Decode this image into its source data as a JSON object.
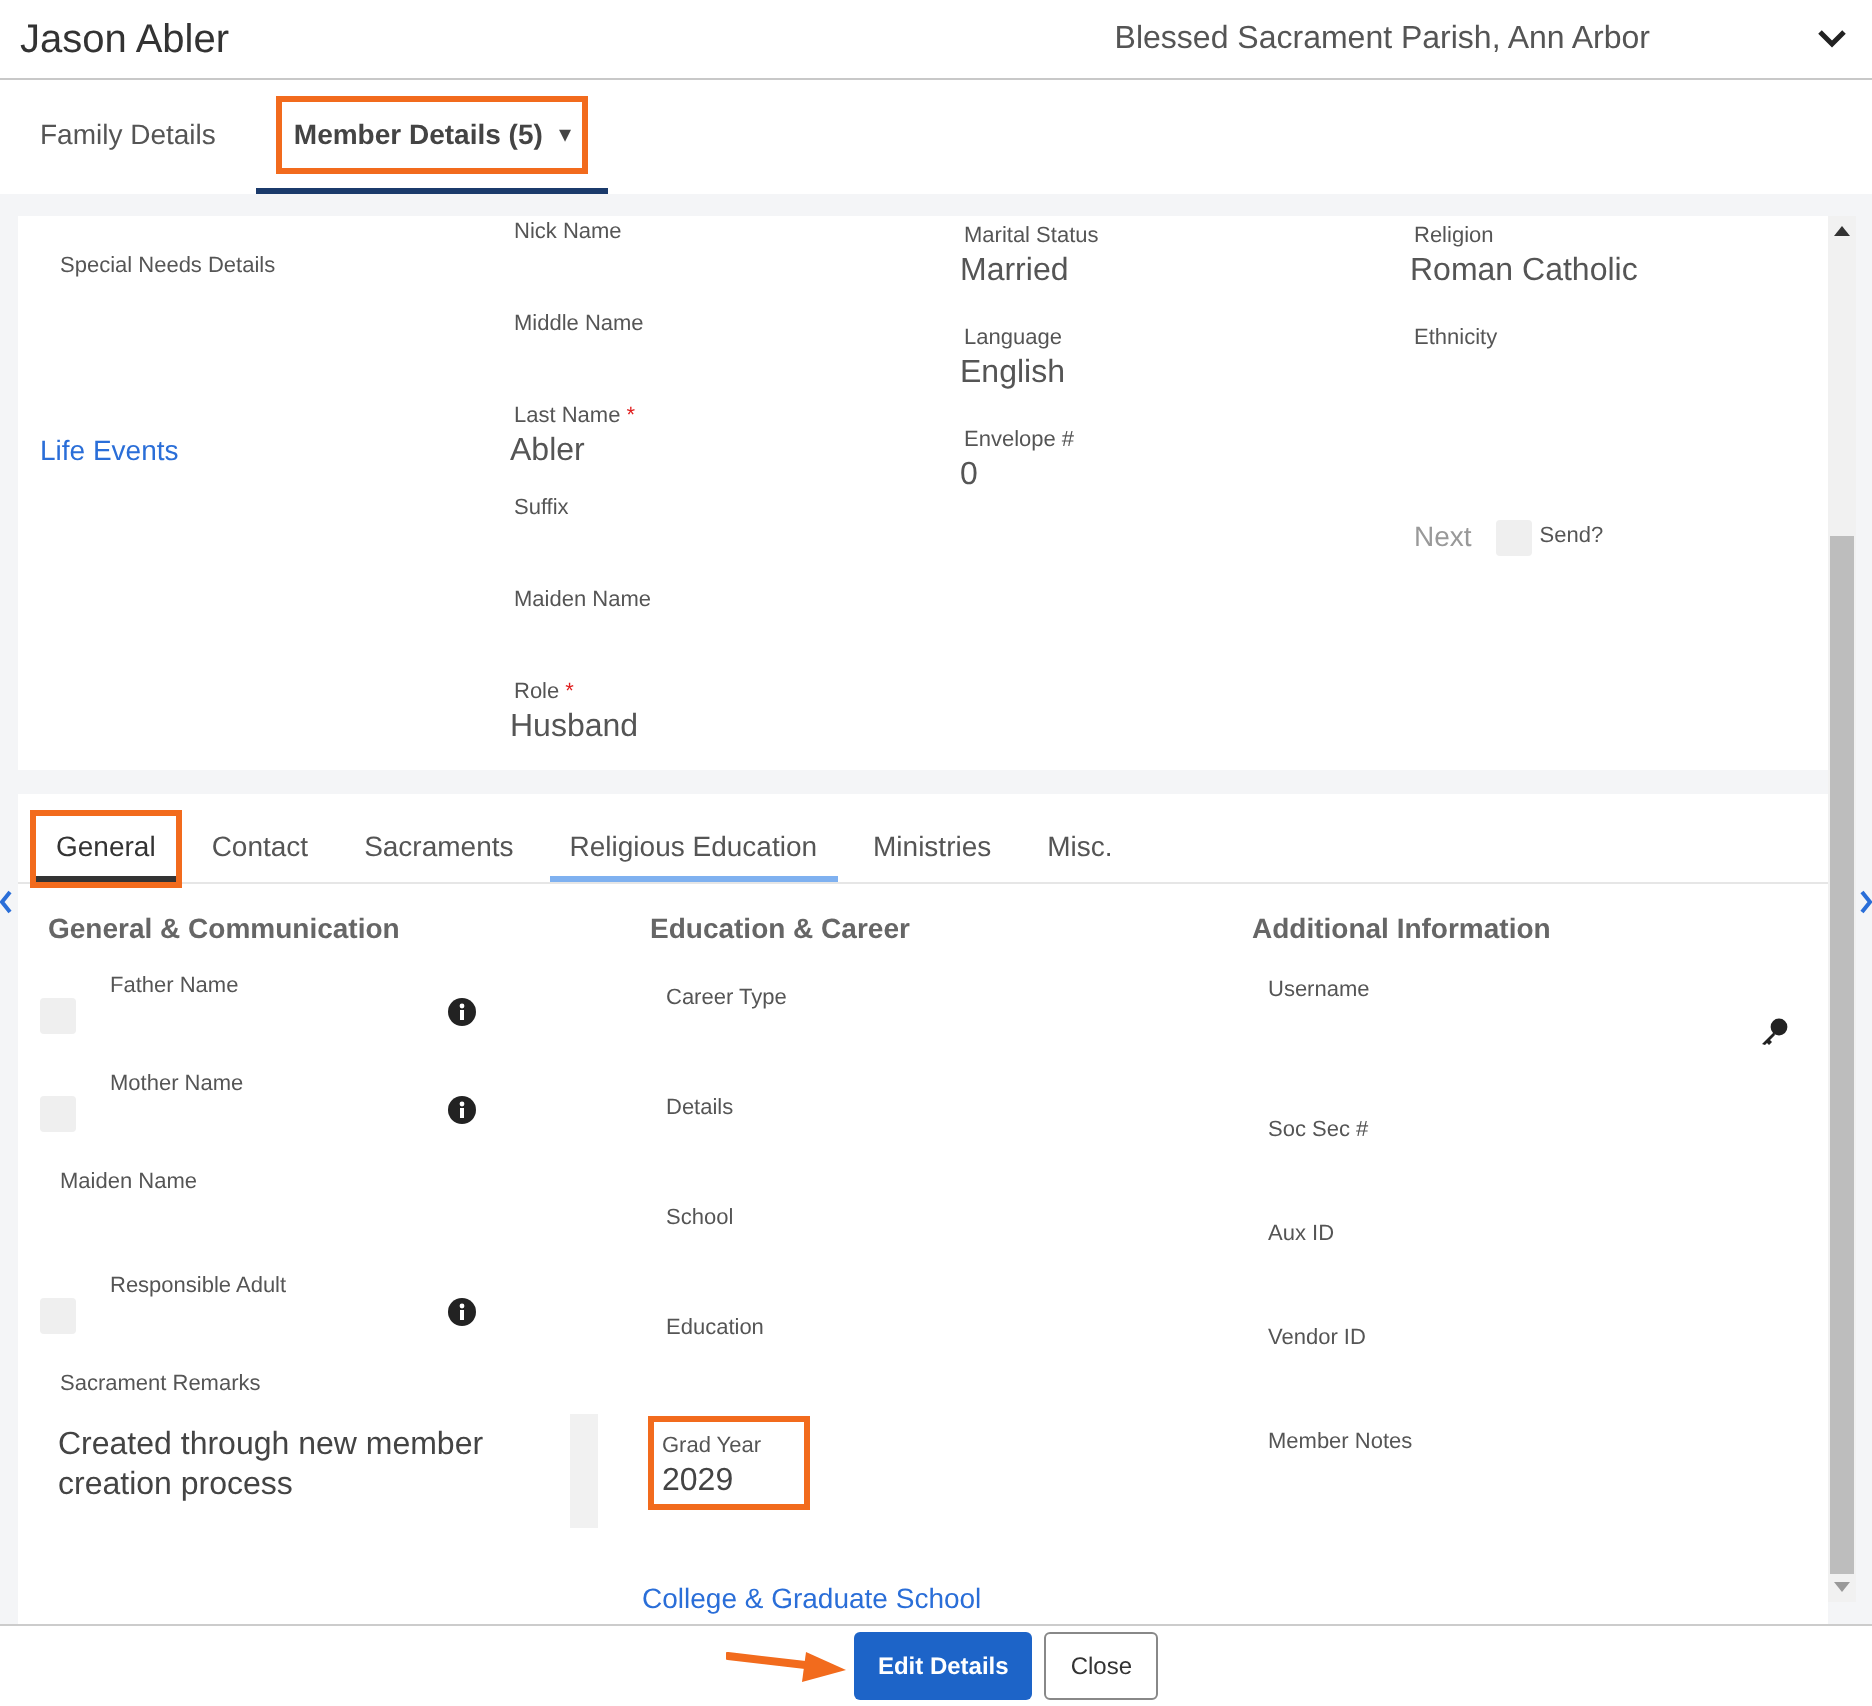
{
  "header": {
    "title": "Jason Abler",
    "parish": "Blessed Sacrament Parish, Ann Arbor"
  },
  "tabs": [
    {
      "label": "Family Details",
      "selected": false,
      "highlighted": false,
      "dropdown": false
    },
    {
      "label": "Member Details (5)",
      "selected": true,
      "highlighted": true,
      "dropdown": "▾"
    }
  ],
  "summary": {
    "columns": [
      [
        {
          "kind": "field",
          "label": "Special Needs Details"
        },
        {
          "kind": "link",
          "label": "Life Events"
        }
      ],
      [
        {
          "kind": "field",
          "label": "Nick Name"
        },
        {
          "kind": "field",
          "label": "Middle Name"
        },
        {
          "kind": "field",
          "label": "Last Name",
          "required_mark": "*",
          "value": "Abler"
        },
        {
          "kind": "field",
          "label": "Suffix"
        },
        {
          "kind": "field",
          "label": "Maiden Name"
        },
        {
          "kind": "field",
          "label": "Role",
          "required_mark": "*",
          "value": "Husband"
        }
      ],
      [
        {
          "kind": "field",
          "label": "Marital Status",
          "value": "Married"
        },
        {
          "kind": "field",
          "label": "Language",
          "value": "English"
        },
        {
          "kind": "field",
          "label": "Envelope #",
          "value": "0"
        }
      ],
      [
        {
          "kind": "field",
          "label": "Religion",
          "value": "Roman Catholic"
        },
        {
          "kind": "field",
          "label": "Ethnicity"
        },
        {
          "kind": "send",
          "prefix": "Next",
          "label": "Send?",
          "checked": false
        }
      ]
    ]
  },
  "section_tabs": [
    {
      "label": "General",
      "selected": true,
      "highlighted": true,
      "hovered": false
    },
    {
      "label": "Contact",
      "selected": false,
      "highlighted": false,
      "hovered": false
    },
    {
      "label": "Sacraments",
      "selected": false,
      "highlighted": false,
      "hovered": false
    },
    {
      "label": "Religious Education",
      "selected": false,
      "highlighted": false,
      "hovered": true
    },
    {
      "label": "Ministries",
      "selected": false,
      "highlighted": false,
      "hovered": false
    },
    {
      "label": "Misc.",
      "selected": false,
      "highlighted": false,
      "hovered": false
    }
  ],
  "sections": [
    {
      "title": "General & Communication",
      "items": [
        {
          "kind": "check",
          "label": "Father Name",
          "checked": false
        },
        {
          "kind": "check",
          "label": "Mother Name",
          "checked": false
        },
        {
          "kind": "field",
          "label": "Maiden Name"
        },
        {
          "kind": "check",
          "label": "Responsible Adult",
          "checked": false
        },
        {
          "kind": "textarea",
          "label": "Sacrament Remarks",
          "value": "Created through new member creation process"
        }
      ]
    },
    {
      "title": "Education & Career",
      "items": [
        {
          "kind": "field",
          "label": "Career Type"
        },
        {
          "kind": "field",
          "label": "Details"
        },
        {
          "kind": "field",
          "label": "School"
        },
        {
          "kind": "field",
          "label": "Education"
        },
        {
          "kind": "field",
          "label": "Grad Year",
          "value": "2029",
          "highlighted": true
        },
        {
          "kind": "link",
          "label": "College & Graduate School"
        }
      ]
    },
    {
      "title": "Additional Information",
      "items": [
        {
          "kind": "secret",
          "label": "Username"
        },
        {
          "kind": "field",
          "label": "Soc Sec #"
        },
        {
          "kind": "field",
          "label": "Aux ID"
        },
        {
          "kind": "field",
          "label": "Vendor ID"
        },
        {
          "kind": "field",
          "label": "Member Notes"
        }
      ]
    }
  ],
  "buttons": [
    {
      "label": "Edit Details",
      "kind": "primary",
      "pointed_at": true
    },
    {
      "label": "Close",
      "kind": "secondary",
      "pointed_at": false
    }
  ]
}
